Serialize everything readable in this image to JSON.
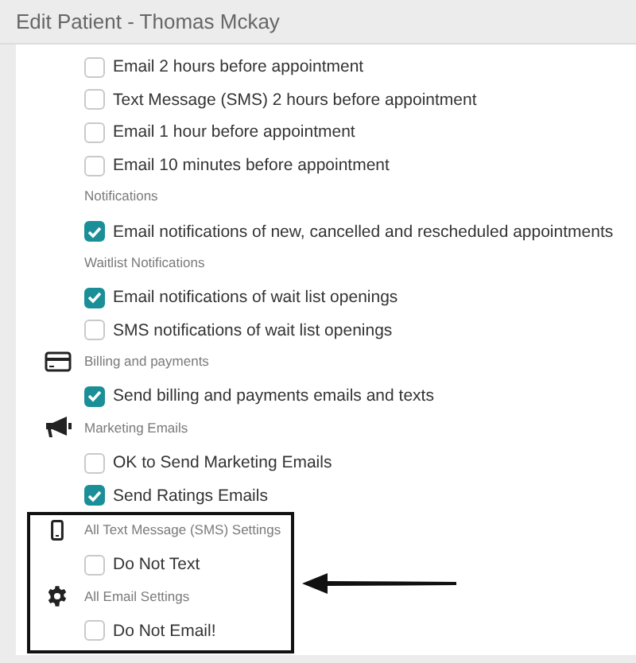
{
  "window": {
    "title": "Edit Patient - Thomas Mckay"
  },
  "sections": [
    {
      "highlighted": false,
      "items": [
        {
          "text": "Email 2 hours before appointment",
          "checked": false
        },
        {
          "text": "Text Message (SMS) 2 hours before appointment",
          "checked": false
        },
        {
          "text": "Email 1 hour before appointment",
          "checked": false
        },
        {
          "text": "Email 10 minutes before appointment",
          "checked": false
        }
      ]
    },
    {
      "label": "Notifications",
      "highlighted": false,
      "items": [
        {
          "text": "Email notifications of new, cancelled and rescheduled appointments",
          "checked": true
        }
      ]
    },
    {
      "label": "Waitlist Notifications",
      "highlighted": false,
      "items": [
        {
          "text": "Email notifications of wait list openings",
          "checked": true
        },
        {
          "text": "SMS notifications of wait list openings",
          "checked": false
        }
      ]
    },
    {
      "label": "Billing and payments",
      "highlighted": false,
      "items": [
        {
          "text": "Send billing and payments emails and texts",
          "checked": true
        }
      ]
    },
    {
      "label": "Marketing Emails",
      "highlighted": false,
      "items": [
        {
          "text": "OK to Send Marketing Emails",
          "checked": false
        },
        {
          "text": "Send Ratings Emails",
          "checked": true
        }
      ]
    },
    {
      "label": "All Text Message (SMS) Settings",
      "highlighted": true,
      "items": [
        {
          "text": "Do Not Text",
          "checked": false
        }
      ]
    },
    {
      "label": "All Email Settings",
      "highlighted": true,
      "items": [
        {
          "text": "Do Not Email!",
          "checked": false
        }
      ]
    }
  ]
}
